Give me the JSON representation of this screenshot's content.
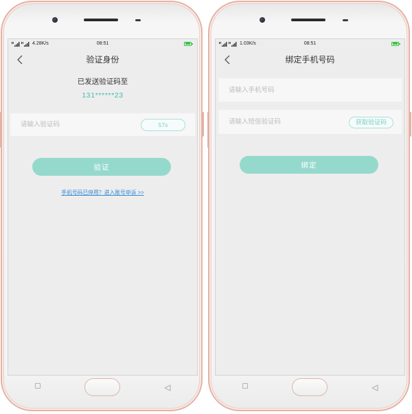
{
  "colors": {
    "accent": "#95d9cd",
    "accent_text": "#3fbfa9",
    "pill_border": "#a8e0d6",
    "pill_text": "#7ccfbf",
    "link": "#2f89d6",
    "frame": "#e2b2a6",
    "battery": "#3cc24a"
  },
  "verify_screen": {
    "status_bar": {
      "net_speed": "4.28K/s",
      "time": "08:51",
      "battery_level": 0.9
    },
    "nav": {
      "title": "验证身份"
    },
    "sent_label": "已发送验证码至",
    "phone_masked": "131******23",
    "code_input": {
      "placeholder": "请输入验证码"
    },
    "countdown_label": "57s",
    "submit_label": "验证",
    "appeal_link": "手机号码已停用？进入账号申诉 >>"
  },
  "bind_screen": {
    "status_bar": {
      "net_speed": "1.03K/s",
      "time": "08:51",
      "battery_level": 0.9
    },
    "nav": {
      "title": "绑定手机号码"
    },
    "phone_input": {
      "placeholder": "请输入手机号码"
    },
    "sms_input": {
      "placeholder": "请输入短信验证码"
    },
    "get_code_label": "获取验证码",
    "submit_label": "绑定"
  },
  "icons": {
    "status_bar": [
      "signal-icon",
      "battery-icon"
    ],
    "nav_bar": [
      "chevron-left-icon"
    ],
    "device_keys": [
      "recent-apps-icon",
      "home-button",
      "back-triangle-icon"
    ]
  }
}
